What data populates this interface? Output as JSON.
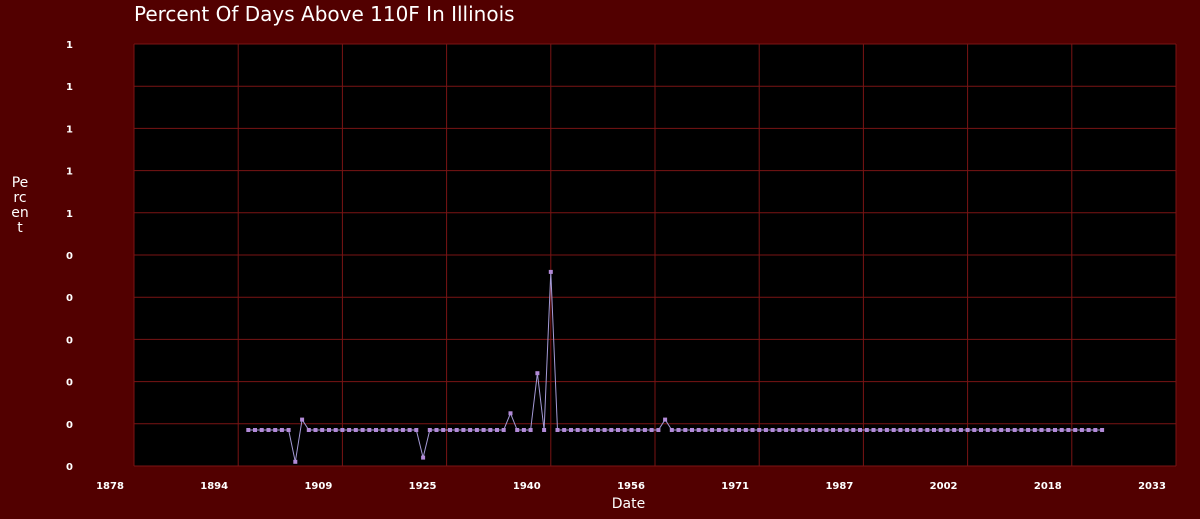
{
  "chart_data": {
    "type": "line",
    "title": "Percent Of Days Above 110F In Illinois",
    "xlabel": "Date",
    "ylabel": "Percent",
    "xlim": [
      1878,
      2033
    ],
    "ylim": [
      0,
      1
    ],
    "x_ticks": [
      "1878",
      "1894",
      "1909",
      "1925",
      "1940",
      "1956",
      "1971",
      "1987",
      "2002",
      "2018",
      "2033"
    ],
    "y_ticks": [
      "0",
      "0",
      "0",
      "0",
      "0",
      "0",
      "1",
      "1",
      "1",
      "1",
      "1"
    ],
    "grid": true,
    "legend": "none",
    "colors": {
      "background": "#520000",
      "plot_background": "#000000",
      "grid": "#7a1414",
      "line": "#a49ad6",
      "marker": "#b28ad8"
    },
    "series": [
      {
        "x": [
          1895,
          1896,
          1897,
          1898,
          1899,
          1900,
          1901,
          1902,
          1903,
          1904,
          1905,
          1906,
          1907,
          1908,
          1909,
          1910,
          1911,
          1912,
          1913,
          1914,
          1915,
          1916,
          1917,
          1918,
          1919,
          1920,
          1921,
          1922,
          1923,
          1924,
          1925,
          1926,
          1927,
          1928,
          1929,
          1930,
          1931,
          1932,
          1933,
          1934,
          1935,
          1936,
          1937,
          1938,
          1939,
          1940,
          1941,
          1942,
          1943,
          1944,
          1945,
          1946,
          1947,
          1948,
          1949,
          1950,
          1951,
          1952,
          1953,
          1954,
          1955,
          1956,
          1957,
          1958,
          1959,
          1960,
          1961,
          1962,
          1963,
          1964,
          1965,
          1966,
          1967,
          1968,
          1969,
          1970,
          1971,
          1972,
          1973,
          1974,
          1975,
          1976,
          1977,
          1978,
          1979,
          1980,
          1981,
          1982,
          1983,
          1984,
          1985,
          1986,
          1987,
          1988,
          1989,
          1990,
          1991,
          1992,
          1993,
          1994,
          1995,
          1996,
          1997,
          1998,
          1999,
          2000,
          2001,
          2002,
          2003,
          2004,
          2005,
          2006,
          2007,
          2008,
          2009,
          2010,
          2011,
          2012,
          2013,
          2014,
          2015,
          2016,
          2017,
          2018,
          2019,
          2020,
          2021,
          2022
        ],
        "y": [
          0,
          0,
          0,
          0,
          0,
          0,
          0,
          0.01,
          0.11,
          0,
          0,
          0,
          0,
          0,
          0,
          0,
          0,
          0,
          0,
          0,
          0,
          0,
          0,
          0,
          0,
          0,
          0.02,
          0,
          0,
          0,
          0,
          0,
          0,
          0,
          0,
          0,
          0,
          0,
          0,
          0.125,
          0,
          0,
          0,
          0.22,
          0,
          0.46,
          0,
          0,
          0,
          0,
          0,
          0,
          0,
          0,
          0,
          0,
          0,
          0,
          0,
          0,
          0,
          0,
          0.11,
          0,
          0,
          0,
          0,
          0,
          0,
          0,
          0,
          0,
          0,
          0,
          0,
          0,
          0,
          0,
          0,
          0,
          0,
          0,
          0,
          0,
          0,
          0,
          0,
          0,
          0,
          0,
          0,
          0,
          0,
          0,
          0,
          0,
          0,
          0,
          0,
          0,
          0,
          0,
          0,
          0,
          0,
          0,
          0,
          0,
          0,
          0,
          0,
          0,
          0,
          0,
          0,
          0,
          0,
          0,
          0,
          0,
          0,
          0,
          0,
          0,
          0,
          0,
          0,
          0
        ]
      }
    ]
  }
}
